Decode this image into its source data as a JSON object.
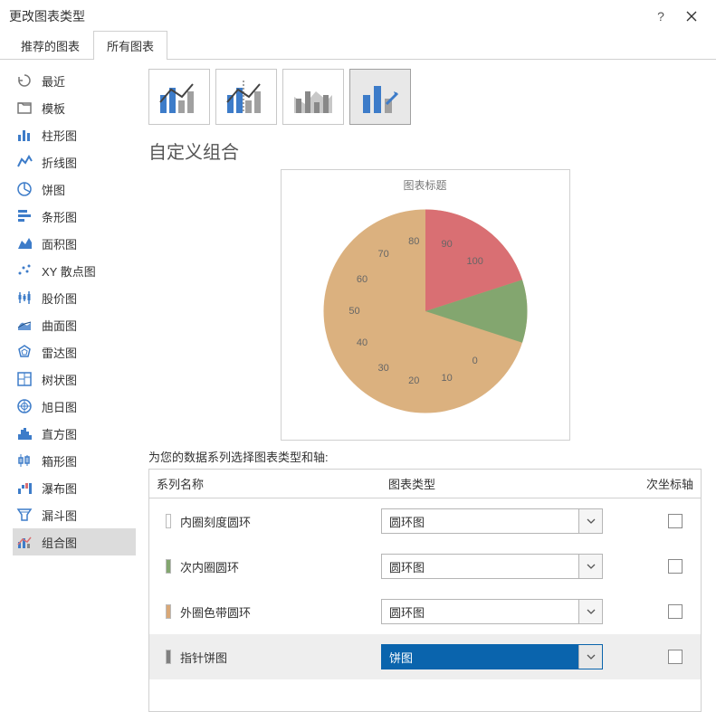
{
  "window": {
    "title": "更改图表类型"
  },
  "tabs": [
    {
      "label": "推荐的图表",
      "active": false
    },
    {
      "label": "所有图表",
      "active": true
    }
  ],
  "sidebar": [
    {
      "id": "recent",
      "label": "最近"
    },
    {
      "id": "templates",
      "label": "模板"
    },
    {
      "id": "column",
      "label": "柱形图"
    },
    {
      "id": "line",
      "label": "折线图"
    },
    {
      "id": "pie",
      "label": "饼图"
    },
    {
      "id": "bar",
      "label": "条形图"
    },
    {
      "id": "area",
      "label": "面积图"
    },
    {
      "id": "scatter",
      "label": "XY 散点图"
    },
    {
      "id": "stock",
      "label": "股价图"
    },
    {
      "id": "surface",
      "label": "曲面图"
    },
    {
      "id": "radar",
      "label": "雷达图"
    },
    {
      "id": "treemap",
      "label": "树状图"
    },
    {
      "id": "sunburst",
      "label": "旭日图"
    },
    {
      "id": "histogram",
      "label": "直方图"
    },
    {
      "id": "boxplot",
      "label": "箱形图"
    },
    {
      "id": "waterfall",
      "label": "瀑布图"
    },
    {
      "id": "funnel",
      "label": "漏斗图"
    },
    {
      "id": "combo",
      "label": "组合图",
      "active": true
    }
  ],
  "main": {
    "section_title": "自定义组合",
    "preview": {
      "title": "图表标题",
      "ticks": [
        "0",
        "10",
        "20",
        "30",
        "40",
        "50",
        "60",
        "70",
        "80",
        "90",
        "100"
      ]
    },
    "series_prompt": "为您的数据系列选择图表类型和轴:",
    "grid": {
      "headers": {
        "name": "系列名称",
        "type": "图表类型",
        "axis": "次坐标轴"
      },
      "rows": [
        {
          "swatch": "#ffffff",
          "name": "内圈刻度圆环",
          "type": "圆环图",
          "selected": false
        },
        {
          "swatch": "#83a66f",
          "name": "次内圈圆环",
          "type": "圆环图",
          "selected": false
        },
        {
          "swatch": "#d9a877",
          "name": "外圈色带圆环",
          "type": "圆环图",
          "selected": false
        },
        {
          "swatch": "#808080",
          "name": "指针饼图",
          "type": "饼图",
          "selected": true
        }
      ]
    }
  },
  "chart_data": {
    "type": "pie",
    "title": "图表标题",
    "series": [
      {
        "name": "指针饼图",
        "values": [
          30,
          10,
          60
        ],
        "colors": [
          "#d96f73",
          "#83a66f",
          "#dbb17f"
        ]
      }
    ],
    "gauge_ticks": [
      0,
      10,
      20,
      30,
      40,
      50,
      60,
      70,
      80,
      90,
      100
    ]
  }
}
